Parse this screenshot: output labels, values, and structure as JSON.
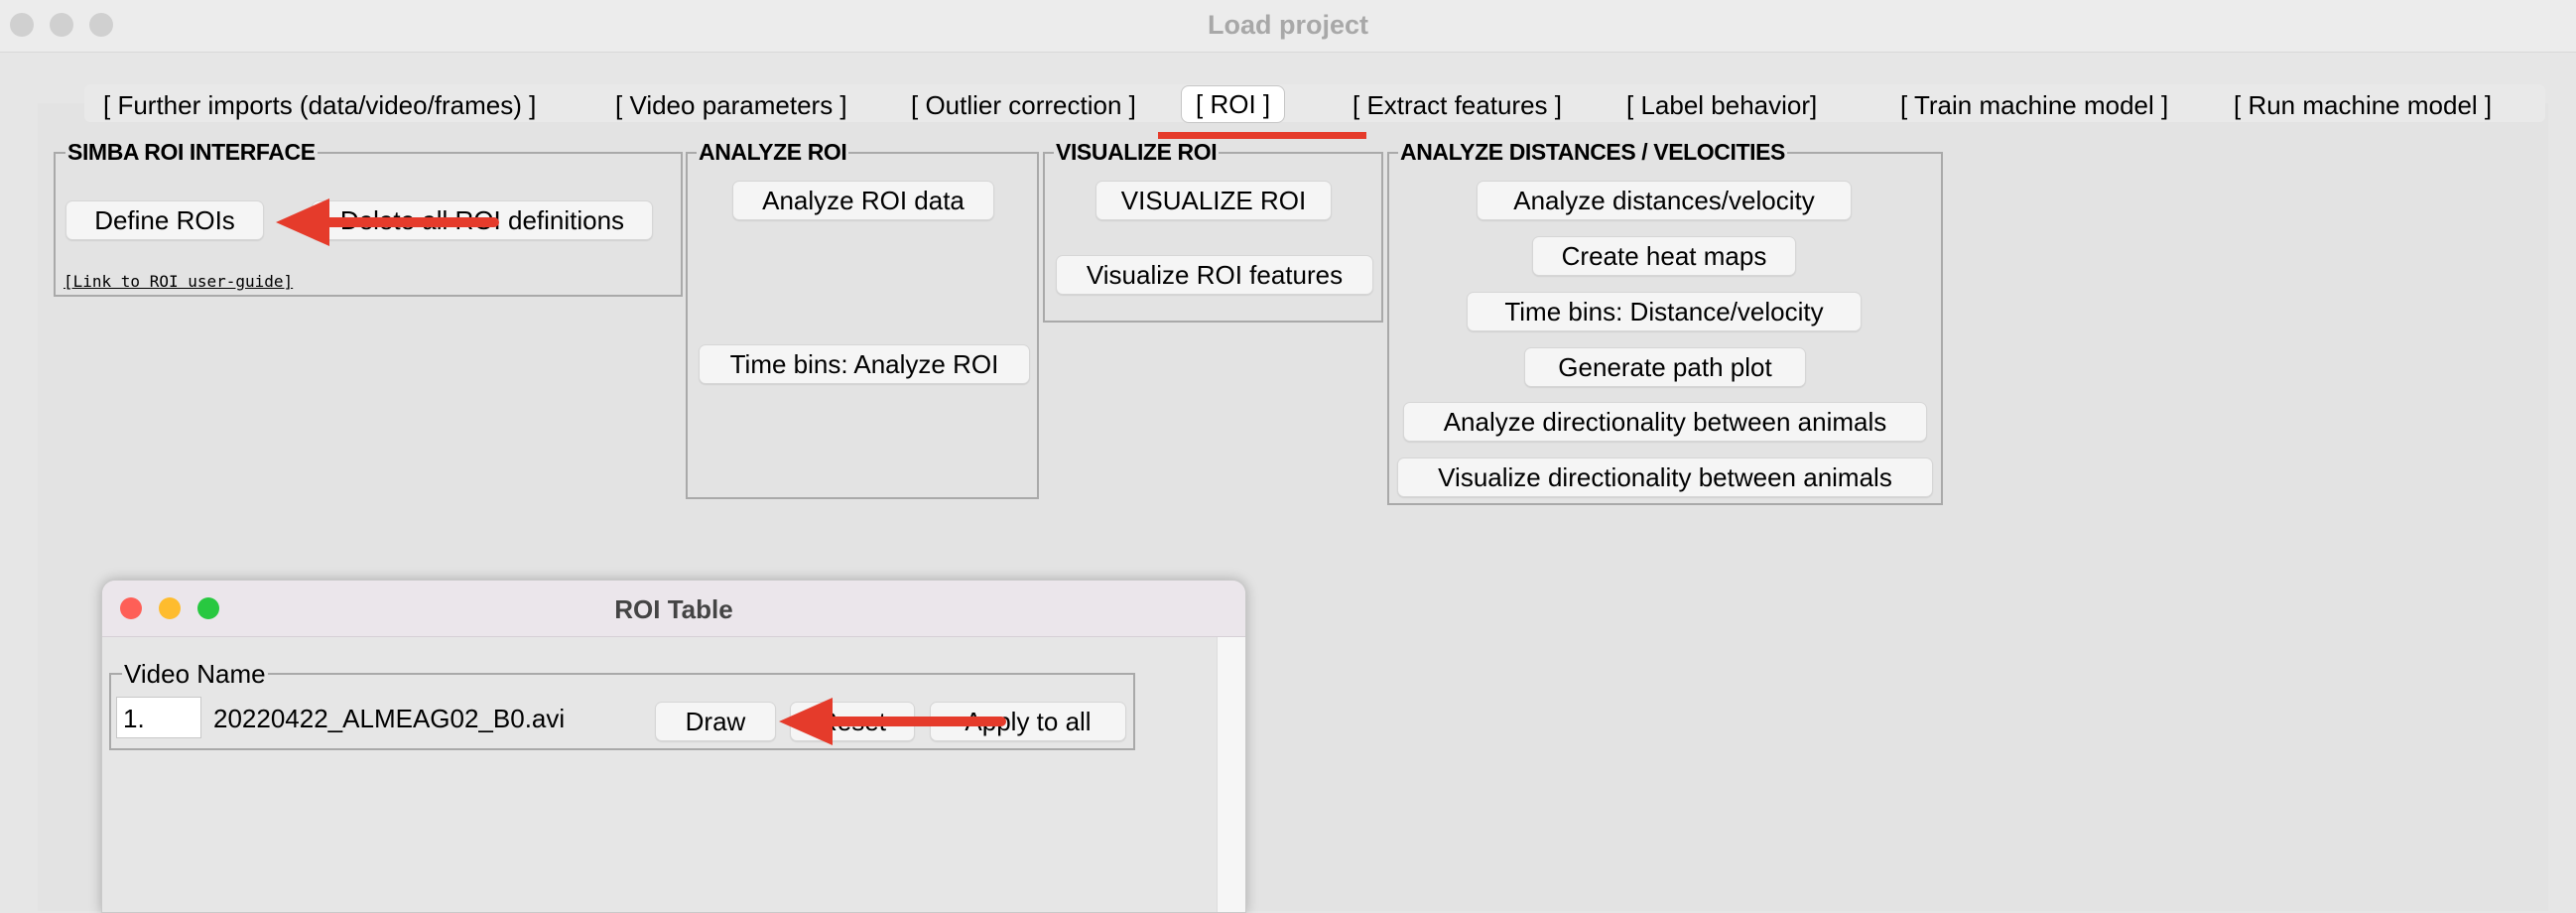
{
  "window": {
    "title": "Load project"
  },
  "tabs": [
    {
      "label": "[ Further imports (data/video/frames) ]"
    },
    {
      "label": "[ Video parameters ]"
    },
    {
      "label": "[ Outlier correction ]"
    },
    {
      "label": "[ ROI ]",
      "active": true
    },
    {
      "label": "[ Extract features ]"
    },
    {
      "label": "[ Label behavior]"
    },
    {
      "label": "[ Train machine model ]"
    },
    {
      "label": "[ Run machine model ]"
    }
  ],
  "groups": {
    "simba_roi": {
      "title": "SIMBA ROI INTERFACE",
      "define_rois": "Define ROIs",
      "delete_all": "Delete all ROI definitions",
      "link": "[Link to ROI user-guide]"
    },
    "analyze_roi": {
      "title": "ANALYZE ROI",
      "analyze_data": "Analyze ROI data",
      "time_bins": "Time bins: Analyze ROI"
    },
    "visualize_roi": {
      "title": "VISUALIZE ROI",
      "visualize": "VISUALIZE ROI",
      "features": "Visualize ROI features"
    },
    "distances": {
      "title": "ANALYZE DISTANCES / VELOCITIES",
      "buttons": [
        "Analyze distances/velocity",
        "Create heat maps",
        "Time bins: Distance/velocity",
        "Generate path plot",
        "Analyze directionality between animals",
        "Visualize directionality between animals"
      ]
    }
  },
  "roi_table": {
    "title": "ROI Table",
    "group_label": "Video Name",
    "row": {
      "index": "1.",
      "video": "20220422_ALMEAG02_B0.avi",
      "draw": "Draw",
      "reset": "Reset",
      "apply_all": "Apply to all"
    }
  },
  "colors": {
    "annotation_arrow": "#e53b2b",
    "active_tab_underline": "#e53b2b"
  }
}
